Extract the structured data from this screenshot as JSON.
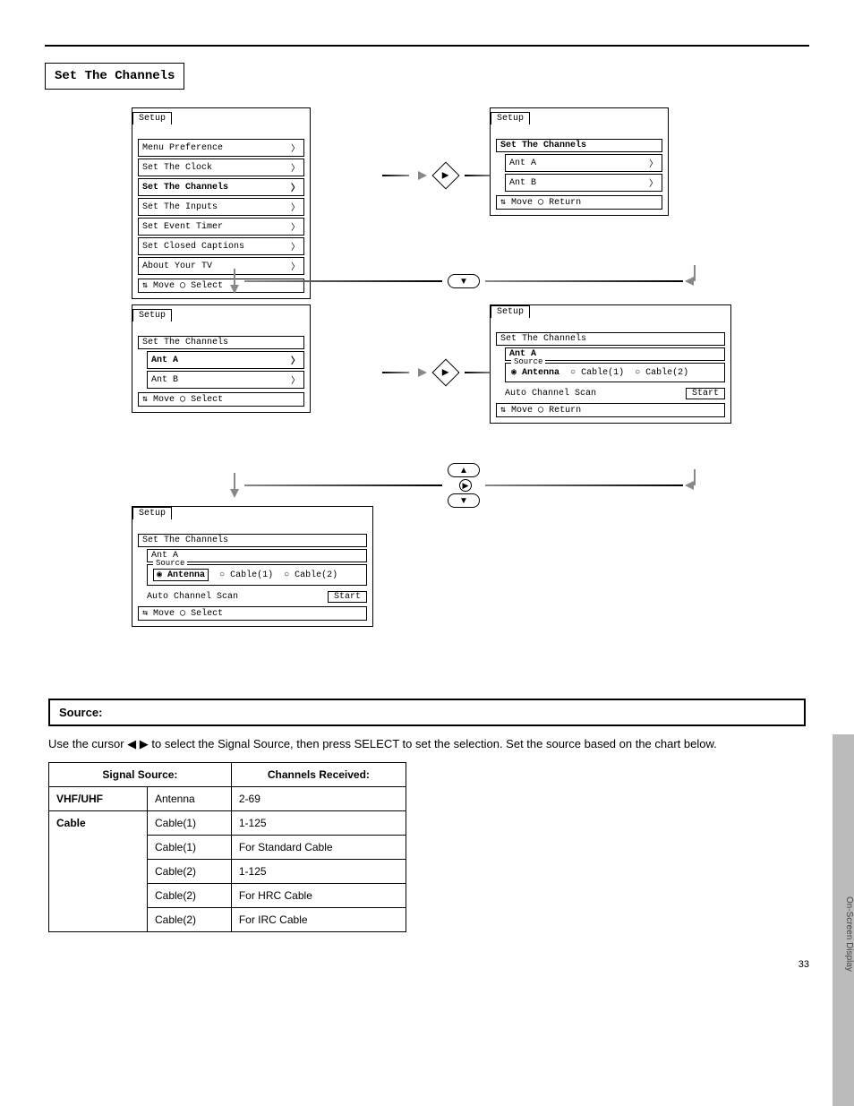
{
  "heading": "Set The Channels",
  "tabs": {
    "setup": "Setup",
    "set_the_channels": "Set The Channels",
    "ant_a": "Ant A"
  },
  "menu1": {
    "items": [
      "Menu Preference",
      "Set The Clock",
      "Set The Channels",
      "Set The Inputs",
      "Set Event Timer",
      "Set Closed Captions",
      "About Your TV"
    ],
    "selected_index": 2,
    "footer_move": "Move",
    "footer_action": "Select"
  },
  "menu2": {
    "items": [
      "Ant A",
      "Ant B"
    ],
    "selected_index": null,
    "footer_move": "Move",
    "footer_action": "Return"
  },
  "menu3": {
    "items": [
      "Ant A",
      "Ant B"
    ],
    "selected_index": 0,
    "footer_move": "Move",
    "footer_action": "Select"
  },
  "ant_panel": {
    "source_label": "Source",
    "options": [
      "Antenna",
      "Cable(1)",
      "Cable(2)"
    ],
    "selected_index": 0,
    "scan_label": "Auto Channel Scan",
    "start": "Start"
  },
  "panel4_footer_move": "Move",
  "panel4_footer_action": "Return",
  "panel5_footer_move": "Move",
  "panel5_footer_action": "Select",
  "source_section": {
    "title": "Source:",
    "para_pre": "Use the cursor ",
    "para_post": " to select the Signal Source, then press SELECT to set the selection. Set the source based on the chart below.",
    "table": {
      "header": [
        "Signal Source:",
        "Channels Received:"
      ],
      "rows": [
        {
          "group": "VHF/UHF",
          "opt": "Antenna",
          "ch": "2-69"
        },
        {
          "group": "Cable",
          "rows": [
            {
              "opt": "Cable(1)",
              "ch": "1-125"
            },
            {
              "opt": "Cable(1)",
              "ch": "For Standard Cable"
            },
            {
              "opt": "Cable(2)",
              "ch": "1-125"
            },
            {
              "opt": "Cable(2)",
              "ch": "For HRC Cable"
            },
            {
              "opt": "Cable(2)",
              "ch": "For IRC Cable"
            }
          ]
        }
      ]
    }
  },
  "sidebar_label": "On-Screen Display",
  "page_number": "33",
  "caption": "On-Screen Display"
}
